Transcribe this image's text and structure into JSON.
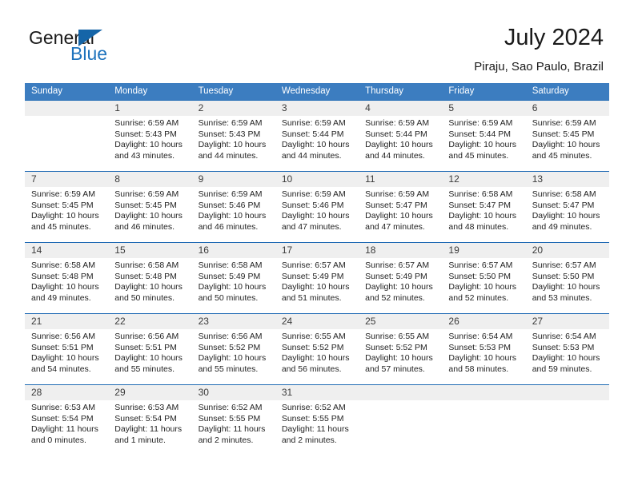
{
  "brand": {
    "name_part1": "General",
    "name_part2": "Blue",
    "flag_icon": "triangle-flag-icon",
    "accent_color": "#1565a8"
  },
  "header": {
    "title": "July 2024",
    "location": "Piraju, Sao Paulo, Brazil"
  },
  "theme": {
    "header_blue": "#3c7dc0",
    "separator_blue": "#1f6ab4",
    "daynum_band": "#efefef"
  },
  "weekday_headers": [
    "Sunday",
    "Monday",
    "Tuesday",
    "Wednesday",
    "Thursday",
    "Friday",
    "Saturday"
  ],
  "weeks": [
    [
      {
        "day": "",
        "lines": [
          "",
          "",
          "",
          ""
        ]
      },
      {
        "day": "1",
        "lines": [
          "Sunrise: 6:59 AM",
          "Sunset: 5:43 PM",
          "Daylight: 10 hours",
          "and 43 minutes."
        ]
      },
      {
        "day": "2",
        "lines": [
          "Sunrise: 6:59 AM",
          "Sunset: 5:43 PM",
          "Daylight: 10 hours",
          "and 44 minutes."
        ]
      },
      {
        "day": "3",
        "lines": [
          "Sunrise: 6:59 AM",
          "Sunset: 5:44 PM",
          "Daylight: 10 hours",
          "and 44 minutes."
        ]
      },
      {
        "day": "4",
        "lines": [
          "Sunrise: 6:59 AM",
          "Sunset: 5:44 PM",
          "Daylight: 10 hours",
          "and 44 minutes."
        ]
      },
      {
        "day": "5",
        "lines": [
          "Sunrise: 6:59 AM",
          "Sunset: 5:44 PM",
          "Daylight: 10 hours",
          "and 45 minutes."
        ]
      },
      {
        "day": "6",
        "lines": [
          "Sunrise: 6:59 AM",
          "Sunset: 5:45 PM",
          "Daylight: 10 hours",
          "and 45 minutes."
        ]
      }
    ],
    [
      {
        "day": "7",
        "lines": [
          "Sunrise: 6:59 AM",
          "Sunset: 5:45 PM",
          "Daylight: 10 hours",
          "and 45 minutes."
        ]
      },
      {
        "day": "8",
        "lines": [
          "Sunrise: 6:59 AM",
          "Sunset: 5:45 PM",
          "Daylight: 10 hours",
          "and 46 minutes."
        ]
      },
      {
        "day": "9",
        "lines": [
          "Sunrise: 6:59 AM",
          "Sunset: 5:46 PM",
          "Daylight: 10 hours",
          "and 46 minutes."
        ]
      },
      {
        "day": "10",
        "lines": [
          "Sunrise: 6:59 AM",
          "Sunset: 5:46 PM",
          "Daylight: 10 hours",
          "and 47 minutes."
        ]
      },
      {
        "day": "11",
        "lines": [
          "Sunrise: 6:59 AM",
          "Sunset: 5:47 PM",
          "Daylight: 10 hours",
          "and 47 minutes."
        ]
      },
      {
        "day": "12",
        "lines": [
          "Sunrise: 6:58 AM",
          "Sunset: 5:47 PM",
          "Daylight: 10 hours",
          "and 48 minutes."
        ]
      },
      {
        "day": "13",
        "lines": [
          "Sunrise: 6:58 AM",
          "Sunset: 5:47 PM",
          "Daylight: 10 hours",
          "and 49 minutes."
        ]
      }
    ],
    [
      {
        "day": "14",
        "lines": [
          "Sunrise: 6:58 AM",
          "Sunset: 5:48 PM",
          "Daylight: 10 hours",
          "and 49 minutes."
        ]
      },
      {
        "day": "15",
        "lines": [
          "Sunrise: 6:58 AM",
          "Sunset: 5:48 PM",
          "Daylight: 10 hours",
          "and 50 minutes."
        ]
      },
      {
        "day": "16",
        "lines": [
          "Sunrise: 6:58 AM",
          "Sunset: 5:49 PM",
          "Daylight: 10 hours",
          "and 50 minutes."
        ]
      },
      {
        "day": "17",
        "lines": [
          "Sunrise: 6:57 AM",
          "Sunset: 5:49 PM",
          "Daylight: 10 hours",
          "and 51 minutes."
        ]
      },
      {
        "day": "18",
        "lines": [
          "Sunrise: 6:57 AM",
          "Sunset: 5:49 PM",
          "Daylight: 10 hours",
          "and 52 minutes."
        ]
      },
      {
        "day": "19",
        "lines": [
          "Sunrise: 6:57 AM",
          "Sunset: 5:50 PM",
          "Daylight: 10 hours",
          "and 52 minutes."
        ]
      },
      {
        "day": "20",
        "lines": [
          "Sunrise: 6:57 AM",
          "Sunset: 5:50 PM",
          "Daylight: 10 hours",
          "and 53 minutes."
        ]
      }
    ],
    [
      {
        "day": "21",
        "lines": [
          "Sunrise: 6:56 AM",
          "Sunset: 5:51 PM",
          "Daylight: 10 hours",
          "and 54 minutes."
        ]
      },
      {
        "day": "22",
        "lines": [
          "Sunrise: 6:56 AM",
          "Sunset: 5:51 PM",
          "Daylight: 10 hours",
          "and 55 minutes."
        ]
      },
      {
        "day": "23",
        "lines": [
          "Sunrise: 6:56 AM",
          "Sunset: 5:52 PM",
          "Daylight: 10 hours",
          "and 55 minutes."
        ]
      },
      {
        "day": "24",
        "lines": [
          "Sunrise: 6:55 AM",
          "Sunset: 5:52 PM",
          "Daylight: 10 hours",
          "and 56 minutes."
        ]
      },
      {
        "day": "25",
        "lines": [
          "Sunrise: 6:55 AM",
          "Sunset: 5:52 PM",
          "Daylight: 10 hours",
          "and 57 minutes."
        ]
      },
      {
        "day": "26",
        "lines": [
          "Sunrise: 6:54 AM",
          "Sunset: 5:53 PM",
          "Daylight: 10 hours",
          "and 58 minutes."
        ]
      },
      {
        "day": "27",
        "lines": [
          "Sunrise: 6:54 AM",
          "Sunset: 5:53 PM",
          "Daylight: 10 hours",
          "and 59 minutes."
        ]
      }
    ],
    [
      {
        "day": "28",
        "lines": [
          "Sunrise: 6:53 AM",
          "Sunset: 5:54 PM",
          "Daylight: 11 hours",
          "and 0 minutes."
        ]
      },
      {
        "day": "29",
        "lines": [
          "Sunrise: 6:53 AM",
          "Sunset: 5:54 PM",
          "Daylight: 11 hours",
          "and 1 minute."
        ]
      },
      {
        "day": "30",
        "lines": [
          "Sunrise: 6:52 AM",
          "Sunset: 5:55 PM",
          "Daylight: 11 hours",
          "and 2 minutes."
        ]
      },
      {
        "day": "31",
        "lines": [
          "Sunrise: 6:52 AM",
          "Sunset: 5:55 PM",
          "Daylight: 11 hours",
          "and 2 minutes."
        ]
      },
      {
        "day": "",
        "lines": [
          "",
          "",
          "",
          ""
        ]
      },
      {
        "day": "",
        "lines": [
          "",
          "",
          "",
          ""
        ]
      },
      {
        "day": "",
        "lines": [
          "",
          "",
          "",
          ""
        ]
      }
    ]
  ]
}
